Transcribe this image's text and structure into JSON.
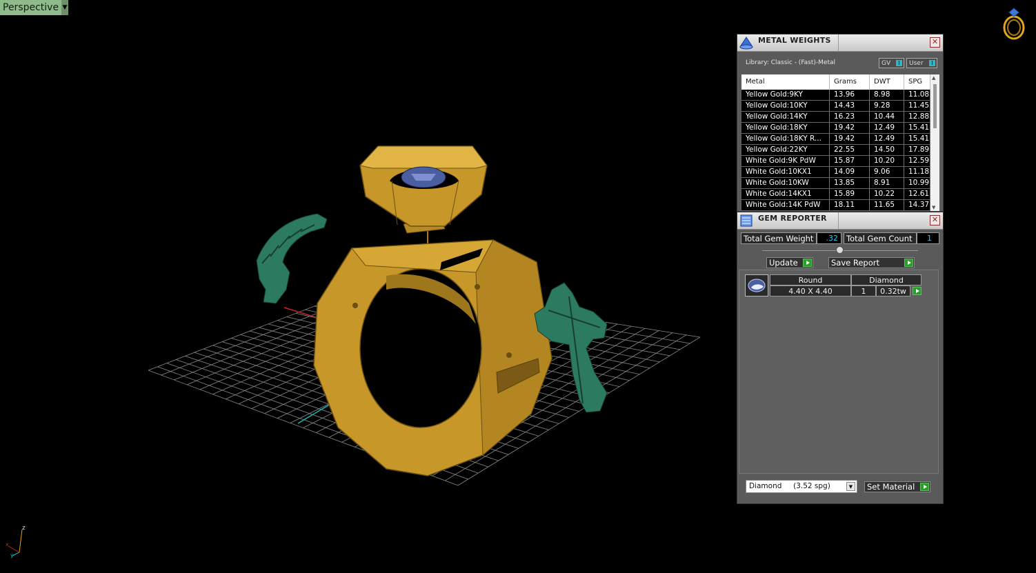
{
  "viewport": {
    "label": "Perspective"
  },
  "metal_weights": {
    "title": "METAL WEIGHTS",
    "library": "Library: Classic - (Fast)-Metal",
    "toggle_gv": "GV",
    "toggle_user": "User",
    "toggle_mark": "I",
    "columns": [
      "Metal",
      "Grams",
      "DWT",
      "SPG"
    ],
    "rows": [
      [
        "Yellow Gold:9KY",
        "13.96",
        "8.98",
        "11.08"
      ],
      [
        "Yellow Gold:10KY",
        "14.43",
        "9.28",
        "11.45"
      ],
      [
        "Yellow Gold:14KY",
        "16.23",
        "10.44",
        "12.88"
      ],
      [
        "Yellow Gold:18KY",
        "19.42",
        "12.49",
        "15.41"
      ],
      [
        "Yellow Gold:18KY R...",
        "19.42",
        "12.49",
        "15.41"
      ],
      [
        "Yellow Gold:22KY",
        "22.55",
        "14.50",
        "17.89"
      ],
      [
        "White Gold:9K PdW",
        "15.87",
        "10.20",
        "12.59"
      ],
      [
        "White Gold:10KX1",
        "14.09",
        "9.06",
        "11.18"
      ],
      [
        "White Gold:10KW",
        "13.85",
        "8.91",
        "10.99"
      ],
      [
        "White Gold:14KX1",
        "15.89",
        "10.22",
        "12.61"
      ],
      [
        "White Gold:14K PdW",
        "18.11",
        "11.65",
        "14.37"
      ]
    ]
  },
  "gem_reporter": {
    "title": "GEM REPORTER",
    "total_weight_label": "Total Gem Weight",
    "total_weight_value": ".32",
    "total_count_label": "Total Gem Count",
    "total_count_value": "1",
    "update_label": "Update",
    "save_label": "Save Report",
    "gem": {
      "shape": "Round",
      "material": "Diamond",
      "size": "4.40 X 4.40",
      "count": "1",
      "weight": "0.32tw"
    },
    "material_select": "Diamond     (3.52 spg)",
    "set_material_label": "Set Material"
  },
  "colors": {
    "metal": "#c9a12f",
    "gem_green": "#2f7f63",
    "panel": "#5a5a5a",
    "accent_green": "#2a9d2a",
    "value_cyan": "#2fc7ff"
  }
}
